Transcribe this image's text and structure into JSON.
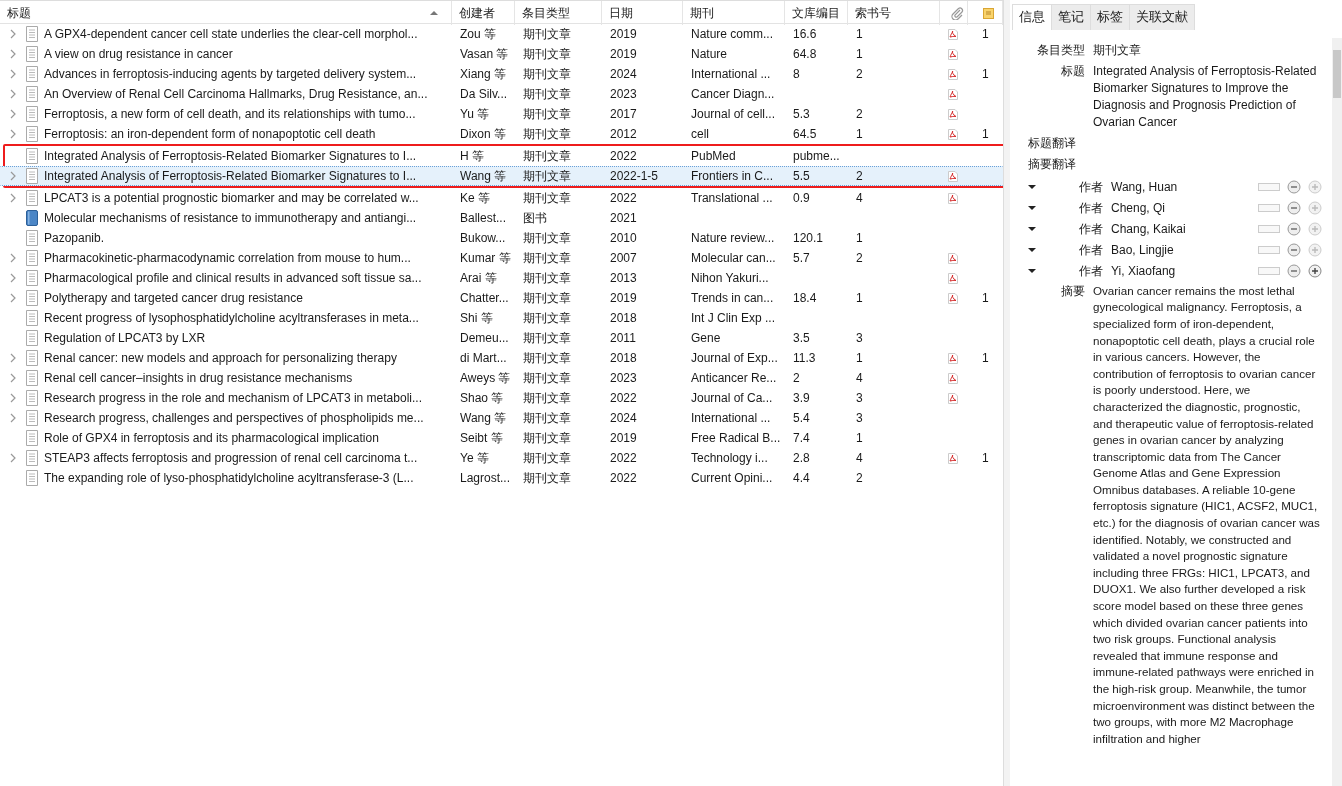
{
  "columns": [
    {
      "label": "标题",
      "sorted": true
    },
    {
      "label": "创建者",
      "sorted": false
    },
    {
      "label": "条目类型",
      "sorted": false
    },
    {
      "label": "日期",
      "sorted": false
    },
    {
      "label": "期刊",
      "sorted": false
    },
    {
      "label": "文库编目",
      "sorted": false
    },
    {
      "label": "索书号",
      "sorted": false
    }
  ],
  "rows": [
    {
      "kind": "article",
      "expandable": true,
      "selected": false,
      "outlined": false,
      "pdf": true,
      "cells": [
        "A GPX4-dependent cancer cell state underlies the clear-cell morphol...",
        "Zou 等",
        "期刊文章",
        "2019",
        "Nature comm...",
        "16.6",
        "1"
      ],
      "notes": "1"
    },
    {
      "kind": "article",
      "expandable": true,
      "selected": false,
      "outlined": false,
      "pdf": true,
      "cells": [
        "A view on drug resistance in cancer",
        "Vasan 等",
        "期刊文章",
        "2019",
        "Nature",
        "64.8",
        "1"
      ]
    },
    {
      "kind": "article",
      "expandable": true,
      "selected": false,
      "outlined": false,
      "pdf": true,
      "cells": [
        "Advances in ferroptosis-inducing agents by targeted delivery system...",
        "Xiang 等",
        "期刊文章",
        "2024",
        "International ...",
        "8",
        "2"
      ],
      "notes": "1"
    },
    {
      "kind": "article",
      "expandable": true,
      "selected": false,
      "outlined": false,
      "pdf": true,
      "cells": [
        "An Overview of Renal Cell Carcinoma Hallmarks, Drug Resistance, an...",
        "Da Silv...",
        "期刊文章",
        "2023",
        "Cancer Diagn...",
        "",
        ""
      ]
    },
    {
      "kind": "article",
      "expandable": true,
      "selected": false,
      "outlined": false,
      "pdf": true,
      "cells": [
        "Ferroptosis, a new form of cell death, and its relationships with tumo...",
        "Yu 等",
        "期刊文章",
        "2017",
        "Journal of cell...",
        "5.3",
        "2"
      ]
    },
    {
      "kind": "article",
      "expandable": true,
      "selected": false,
      "outlined": false,
      "pdf": true,
      "cells": [
        "Ferroptosis: an iron-dependent form of nonapoptotic cell death",
        "Dixon 等",
        "期刊文章",
        "2012",
        "cell",
        "64.5",
        "1"
      ],
      "notes": "1"
    },
    {
      "kind": "article",
      "expandable": false,
      "selected": false,
      "outlined": true,
      "pdf": false,
      "cells": [
        "Integrated Analysis of Ferroptosis-Related Biomarker Signatures to I...",
        "H 等",
        "期刊文章",
        "2022",
        "PubMed",
        "pubme...",
        ""
      ]
    },
    {
      "kind": "article",
      "expandable": true,
      "selected": true,
      "outlined": true,
      "pdf": true,
      "cells": [
        "Integrated Analysis of Ferroptosis-Related Biomarker Signatures to I...",
        "Wang 等",
        "期刊文章",
        "2022-1-5",
        "Frontiers in C...",
        "5.5",
        "2"
      ]
    },
    {
      "kind": "article",
      "expandable": true,
      "selected": false,
      "outlined": false,
      "pdf": true,
      "cells": [
        "LPCAT3 is a potential prognostic biomarker and may be correlated w...",
        "Ke 等",
        "期刊文章",
        "2022",
        "Translational ...",
        "0.9",
        "4"
      ]
    },
    {
      "kind": "book",
      "expandable": false,
      "selected": false,
      "outlined": false,
      "pdf": false,
      "cells": [
        "Molecular mechanisms of resistance to immunotherapy and antiangi...",
        "Ballest...",
        "图书",
        "2021",
        "",
        "",
        ""
      ]
    },
    {
      "kind": "article",
      "expandable": false,
      "selected": false,
      "outlined": false,
      "pdf": false,
      "cells": [
        "Pazopanib.",
        "Bukow...",
        "期刊文章",
        "2010",
        "Nature review...",
        "120.1",
        "1"
      ]
    },
    {
      "kind": "article",
      "expandable": true,
      "selected": false,
      "outlined": false,
      "pdf": true,
      "cells": [
        "Pharmacokinetic-pharmacodynamic correlation from mouse to hum...",
        "Kumar 等",
        "期刊文章",
        "2007",
        "Molecular can...",
        "5.7",
        "2"
      ]
    },
    {
      "kind": "article",
      "expandable": true,
      "selected": false,
      "outlined": false,
      "pdf": true,
      "cells": [
        "Pharmacological profile and clinical results in advanced soft tissue sa...",
        "Arai 等",
        "期刊文章",
        "2013",
        "Nihon Yakuri...",
        "",
        ""
      ]
    },
    {
      "kind": "article",
      "expandable": true,
      "selected": false,
      "outlined": false,
      "pdf": true,
      "cells": [
        "Polytherapy and targeted cancer drug resistance",
        "Chatter...",
        "期刊文章",
        "2019",
        "Trends in can...",
        "18.4",
        "1"
      ],
      "notes": "1"
    },
    {
      "kind": "article",
      "expandable": false,
      "selected": false,
      "outlined": false,
      "pdf": false,
      "cells": [
        "Recent progress of lysophosphatidylcholine acyltransferases in meta...",
        "Shi 等",
        "期刊文章",
        "2018",
        "Int J Clin Exp ...",
        "",
        ""
      ]
    },
    {
      "kind": "article",
      "expandable": false,
      "selected": false,
      "outlined": false,
      "pdf": false,
      "cells": [
        "Regulation of LPCAT3 by LXR",
        "Demeu...",
        "期刊文章",
        "2011",
        "Gene",
        "3.5",
        "3"
      ]
    },
    {
      "kind": "article",
      "expandable": true,
      "selected": false,
      "outlined": false,
      "pdf": true,
      "cells": [
        "Renal cancer: new models and approach for personalizing therapy",
        "di Mart...",
        "期刊文章",
        "2018",
        "Journal of Exp...",
        "11.3",
        "1"
      ],
      "notes": "1"
    },
    {
      "kind": "article",
      "expandable": true,
      "selected": false,
      "outlined": false,
      "pdf": true,
      "cells": [
        "Renal cell cancer–insights in drug resistance mechanisms",
        "Aweys 等",
        "期刊文章",
        "2023",
        "Anticancer Re...",
        "2",
        "4"
      ]
    },
    {
      "kind": "article",
      "expandable": true,
      "selected": false,
      "outlined": false,
      "pdf": true,
      "cells": [
        "Research progress in the role and mechanism of LPCAT3 in metaboli...",
        "Shao 等",
        "期刊文章",
        "2022",
        "Journal of Ca...",
        "3.9",
        "3"
      ]
    },
    {
      "kind": "article",
      "expandable": true,
      "selected": false,
      "outlined": false,
      "pdf": false,
      "cells": [
        "Research progress, challenges and perspectives of phospholipids me...",
        "Wang 等",
        "期刊文章",
        "2024",
        "International ...",
        "5.4",
        "3"
      ]
    },
    {
      "kind": "article",
      "expandable": false,
      "selected": false,
      "outlined": false,
      "pdf": false,
      "cells": [
        "Role of GPX4 in ferroptosis and its pharmacological implication",
        "Seibt 等",
        "期刊文章",
        "2019",
        "Free Radical B...",
        "7.4",
        "1"
      ]
    },
    {
      "kind": "article",
      "expandable": true,
      "selected": false,
      "outlined": false,
      "pdf": true,
      "cells": [
        "STEAP3 affects ferroptosis and progression of renal cell carcinoma t...",
        "Ye 等",
        "期刊文章",
        "2022",
        "Technology i...",
        "2.8",
        "4"
      ],
      "notes": "1"
    },
    {
      "kind": "article",
      "expandable": false,
      "selected": false,
      "outlined": false,
      "pdf": false,
      "cells": [
        "The expanding role of lyso-phosphatidylcholine acyltransferase-3 (L...",
        "Lagrost...",
        "期刊文章",
        "2022",
        "Current Opini...",
        "4.4",
        "2"
      ]
    }
  ],
  "tabs": [
    {
      "label": "信息",
      "selected": true
    },
    {
      "label": "笔记",
      "selected": false
    },
    {
      "label": "标签",
      "selected": false
    },
    {
      "label": "关联文献",
      "selected": false
    }
  ],
  "fields_top": [
    {
      "kind": "value",
      "label": "条目类型",
      "value": "期刊文章"
    },
    {
      "kind": "value",
      "label": "标题",
      "value": "Integrated Analysis of Ferroptosis-Related Biomarker Signatures to Improve the Diagnosis and Prognosis Prediction of Ovarian Cancer"
    },
    {
      "kind": "empty",
      "label": "标题翻译"
    },
    {
      "kind": "empty",
      "label": "摘要翻译"
    }
  ],
  "creators": [
    {
      "label": "作者",
      "name": "Wang, Huan",
      "plus_enabled": false
    },
    {
      "label": "作者",
      "name": "Cheng, Qi",
      "plus_enabled": false
    },
    {
      "label": "作者",
      "name": "Chang, Kaikai",
      "plus_enabled": false
    },
    {
      "label": "作者",
      "name": "Bao, Lingjie",
      "plus_enabled": false
    },
    {
      "label": "作者",
      "name": "Yi, Xiaofang",
      "plus_enabled": true
    }
  ],
  "abstract": {
    "label": "摘要",
    "value": "Ovarian cancer remains the most lethal gynecological malignancy. Ferroptosis, a specialized form of iron-dependent, nonapoptotic cell death, plays a crucial role in various cancers. However, the contribution of ferroptosis to ovarian cancer is poorly understood. Here, we characterized the diagnostic, prognostic, and therapeutic value of ferroptosis-related genes in ovarian cancer by analyzing transcriptomic data from The Cancer Genome Atlas and Gene Expression Omnibus databases. A reliable 10-gene ferroptosis signature (HIC1, ACSF2, MUC1, etc.) for the diagnosis of ovarian cancer was identified. Notably, we constructed and validated a novel prognostic signature including three FRGs: HIC1, LPCAT3, and DUOX1. We also further developed a risk score model based on these three genes which divided ovarian cancer patients into two risk groups. Functional analysis revealed that immune response and immune-related pathways were enriched in the high-risk group. Meanwhile, the tumor microenvironment was distinct between the two groups, with more M2 Macrophage infiltration and higher"
  }
}
